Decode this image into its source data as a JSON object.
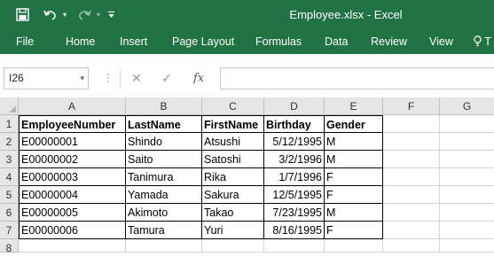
{
  "window": {
    "title": "Employee.xlsx  -  Excel"
  },
  "quick_access": {
    "save_icon": "save-icon",
    "undo_icon": "undo-icon",
    "redo_icon": "redo-icon",
    "customize_icon": "customize-qat-icon"
  },
  "ribbon": {
    "tabs": [
      "File",
      "Home",
      "Insert",
      "Page Layout",
      "Formulas",
      "Data",
      "Review",
      "View"
    ],
    "tell_me": "T",
    "tell_me_icon": "lightbulb-icon"
  },
  "formula_bar": {
    "name_box": "I26",
    "fx_label": "fx",
    "formula": ""
  },
  "grid": {
    "columns": [
      "A",
      "B",
      "C",
      "D",
      "E",
      "F",
      "G"
    ],
    "rows": [
      "1",
      "2",
      "3",
      "4",
      "5",
      "6",
      "7",
      "8"
    ],
    "header": [
      "EmployeeNumber",
      "LastName",
      "FirstName",
      "Birthday",
      "Gender"
    ],
    "data": [
      [
        "E00000001",
        "Shindo",
        "Atsushi",
        "5/12/1995",
        "M"
      ],
      [
        "E00000002",
        "Saito",
        "Satoshi",
        "3/2/1996",
        "M"
      ],
      [
        "E00000003",
        "Tanimura",
        "Rika",
        "1/7/1996",
        "F"
      ],
      [
        "E00000004",
        "Yamada",
        "Sakura",
        "12/5/1995",
        "F"
      ],
      [
        "E00000005",
        "Akimoto",
        "Takao",
        "7/23/1995",
        "M"
      ],
      [
        "E00000006",
        "Tamura",
        "Yuri",
        "8/16/1995",
        "F"
      ]
    ]
  },
  "colors": {
    "accent": "#217346",
    "header_bg": "#e6e6e6",
    "gridline": "#d4d4d4"
  }
}
